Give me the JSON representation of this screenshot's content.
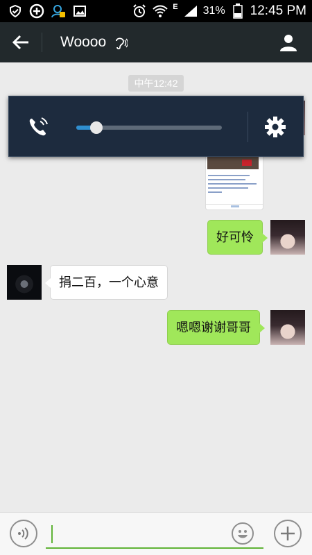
{
  "status_bar": {
    "left_icons": [
      "shield-icon",
      "plus-circle-icon",
      "notification-person-icon",
      "gallery-icon"
    ],
    "network_label": "E",
    "battery_percent": "31%",
    "time": "12:45 PM"
  },
  "header": {
    "title": "Woooo",
    "back_icon": "arrow-left-icon",
    "mode_icon": "earpiece-icon",
    "profile_icon": "person-icon",
    "background": "#22292c"
  },
  "chat": {
    "timestamp": "中午12:42",
    "messages": [
      {
        "side": "right",
        "type": "image"
      },
      {
        "side": "right",
        "type": "text",
        "text": "好可怜"
      },
      {
        "side": "left",
        "type": "text",
        "text": "捐二百，一个心意"
      },
      {
        "side": "right",
        "type": "text",
        "text": "嗯嗯谢谢哥哥"
      }
    ],
    "outgoing_bubble_color": "#a0e75a",
    "incoming_bubble_color": "#ffffff"
  },
  "volume_overlay": {
    "stream_icon": "in-call-volume-icon",
    "level": 0.14,
    "settings_icon": "gear-icon",
    "accent": "#2f8fd0"
  },
  "input_bar": {
    "voice_icon": "voice-icon",
    "text_value": "",
    "emoji_icon": "smiley-icon",
    "more_icon": "plus-icon",
    "accent": "#5fb336"
  }
}
